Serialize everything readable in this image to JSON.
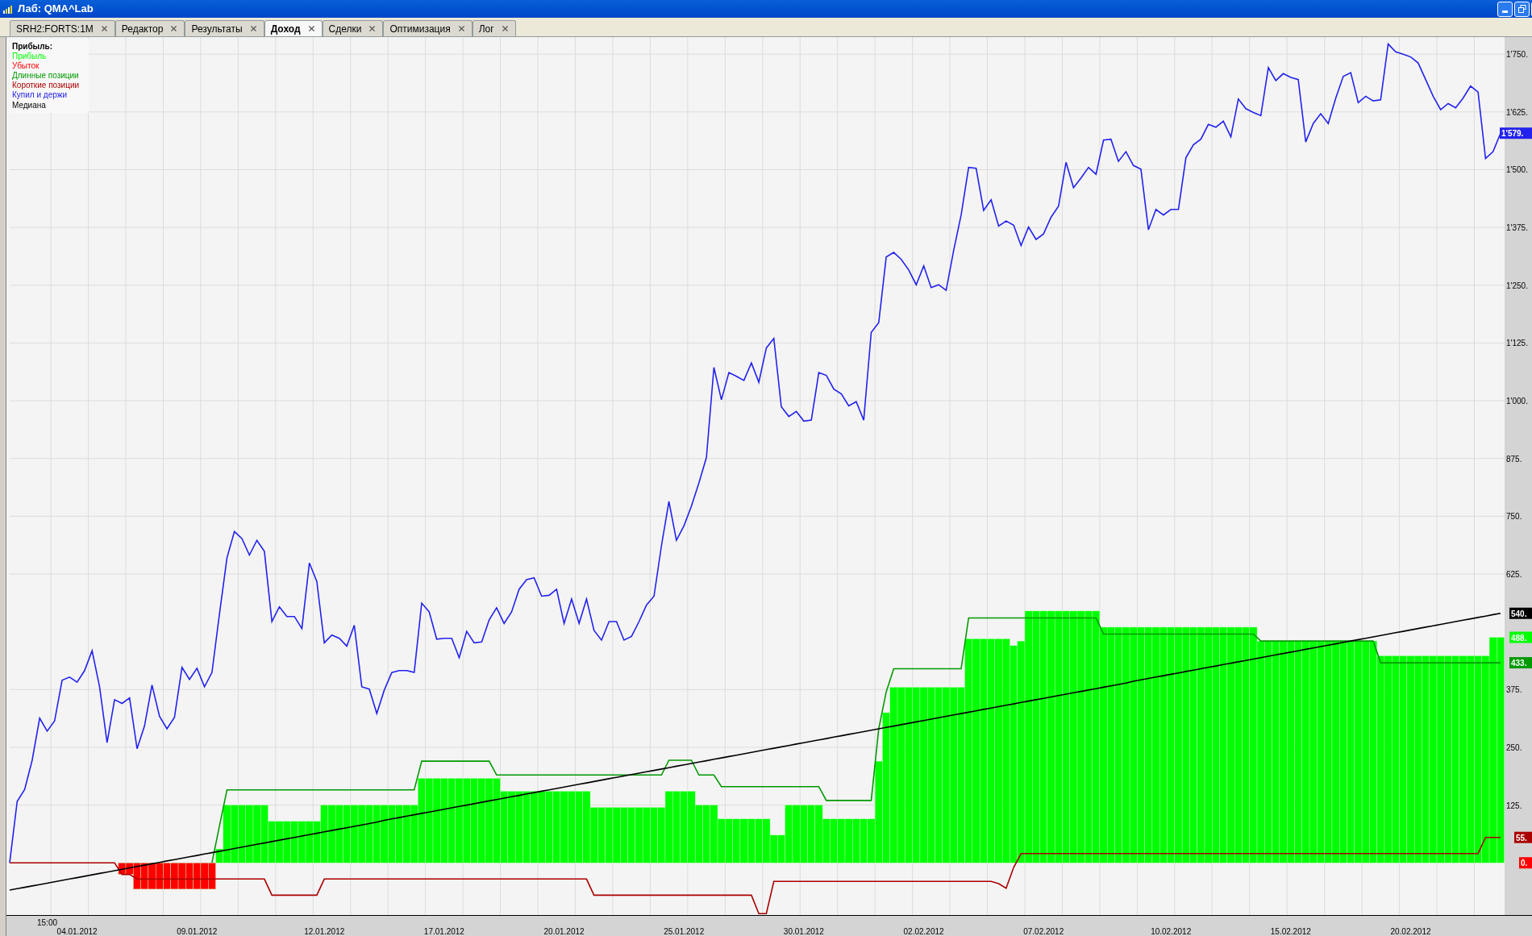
{
  "window": {
    "title": "Лаб: QMA^Lab"
  },
  "tabs": [
    {
      "label": "SRH2:FORTS:1M",
      "selected": false
    },
    {
      "label": "Редактор",
      "selected": false
    },
    {
      "label": "Результаты",
      "selected": false
    },
    {
      "label": "Доход",
      "selected": true
    },
    {
      "label": "Сделки",
      "selected": false
    },
    {
      "label": "Оптимизация",
      "selected": false
    },
    {
      "label": "Лог",
      "selected": false
    }
  ],
  "chart": {
    "time_label": "15:00",
    "end_labels": [
      {
        "text": "1'579.",
        "color": "#2222ee"
      },
      {
        "text": "540.",
        "color": "#000000"
      },
      {
        "text": "488.",
        "color": "#00ff00"
      },
      {
        "text": "433.",
        "color": "#009900"
      },
      {
        "text": "55.",
        "color": "#aa0000"
      },
      {
        "text": "0.",
        "color": "#ff0000"
      }
    ],
    "chart_data": {
      "type": "bar",
      "stacked": false,
      "grid": true,
      "title": "Прибыль:",
      "ylim": [
        -113,
        1787
      ],
      "categories": [
        null,
        null,
        null,
        null,
        null,
        null,
        null,
        null,
        null,
        "04.01.2012",
        null,
        null,
        null,
        null,
        null,
        null,
        null,
        null,
        null,
        null,
        null,
        null,
        null,
        null,
        null,
        "09.01.2012",
        null,
        null,
        null,
        null,
        null,
        null,
        null,
        null,
        null,
        null,
        null,
        null,
        null,
        null,
        null,
        null,
        "12.01.2012",
        null,
        null,
        null,
        null,
        null,
        null,
        null,
        null,
        null,
        null,
        null,
        null,
        null,
        null,
        null,
        "17.01.2012",
        null,
        null,
        null,
        null,
        null,
        null,
        null,
        null,
        null,
        null,
        null,
        null,
        null,
        null,
        null,
        "20.01.2012",
        null,
        null,
        null,
        null,
        null,
        null,
        null,
        null,
        null,
        null,
        null,
        null,
        null,
        null,
        null,
        "25.01.2012",
        null,
        null,
        null,
        null,
        null,
        null,
        null,
        null,
        null,
        null,
        null,
        null,
        null,
        null,
        null,
        "30.01.2012",
        null,
        null,
        null,
        null,
        null,
        null,
        null,
        null,
        null,
        null,
        null,
        null,
        null,
        null,
        null,
        "02.02.2012",
        null,
        null,
        null,
        null,
        null,
        null,
        null,
        null,
        null,
        null,
        null,
        null,
        null,
        null,
        null,
        "07.02.2012",
        null,
        null,
        null,
        null,
        null,
        null,
        null,
        null,
        null,
        null,
        null,
        null,
        null,
        null,
        null,
        null,
        "10.02.2012",
        null,
        null,
        null,
        null,
        null,
        null,
        null,
        null,
        null,
        null,
        null,
        null,
        null,
        null,
        null,
        "15.02.2012",
        null,
        null,
        null,
        null,
        null,
        null,
        null,
        null,
        null,
        null,
        null,
        null,
        null,
        null,
        null,
        "20.02.2012",
        null,
        null,
        null,
        null,
        null,
        null,
        null,
        null,
        null,
        null,
        null,
        null
      ],
      "yticks": [
        {
          "value": 1750,
          "label": "1'750."
        },
        {
          "value": 1625,
          "label": "1'625."
        },
        {
          "value": 1500,
          "label": "1'500."
        },
        {
          "value": 1375,
          "label": "1'375."
        },
        {
          "value": 1250,
          "label": "1'250."
        },
        {
          "value": 1125,
          "label": "1'125."
        },
        {
          "value": 1000,
          "label": "1'000."
        },
        {
          "value": 875,
          "label": "875."
        },
        {
          "value": 750,
          "label": "750."
        },
        {
          "value": 625,
          "label": "625."
        },
        {
          "value": 375,
          "label": "375."
        },
        {
          "value": 250,
          "label": "250."
        },
        {
          "value": 125,
          "label": "125."
        }
      ],
      "series": [
        {
          "name": "Прибыль",
          "type": "bar",
          "color": "#00ff00",
          "values": [
            0,
            0,
            0,
            0,
            0,
            0,
            0,
            0,
            0,
            0,
            0,
            0,
            0,
            0,
            0,
            0,
            0,
            0,
            0,
            0,
            0,
            0,
            0,
            0,
            0,
            0,
            0,
            0,
            30,
            125,
            125,
            125,
            125,
            125,
            125,
            90,
            90,
            90,
            90,
            90,
            90,
            90,
            125,
            125,
            125,
            125,
            125,
            125,
            125,
            125,
            125,
            125,
            125,
            125,
            125,
            183,
            183,
            183,
            183,
            183,
            183,
            183,
            183,
            183,
            183,
            183,
            155,
            155,
            155,
            155,
            155,
            155,
            155,
            155,
            155,
            155,
            155,
            155,
            120,
            120,
            120,
            120,
            120,
            120,
            120,
            120,
            120,
            120,
            155,
            155,
            155,
            155,
            125,
            125,
            125,
            95,
            95,
            95,
            95,
            95,
            95,
            95,
            60,
            60,
            125,
            125,
            125,
            125,
            125,
            95,
            95,
            95,
            95,
            95,
            95,
            95,
            220,
            325,
            380,
            380,
            380,
            380,
            380,
            380,
            380,
            380,
            380,
            380,
            485,
            485,
            485,
            485,
            485,
            485,
            470,
            480,
            545,
            545,
            545,
            545,
            545,
            545,
            545,
            545,
            545,
            545,
            510,
            510,
            510,
            510,
            510,
            510,
            510,
            510,
            510,
            510,
            510,
            510,
            510,
            510,
            510,
            510,
            510,
            510,
            510,
            510,
            510,
            480,
            480,
            480,
            480,
            480,
            480,
            480,
            480,
            480,
            480,
            480,
            480,
            480,
            480,
            480,
            480,
            448,
            448,
            448,
            448,
            448,
            448,
            448,
            448,
            448,
            448,
            448,
            448,
            448,
            448,
            448,
            488,
            488
          ]
        },
        {
          "name": "Убыток",
          "type": "bar",
          "color": "#ff0000",
          "values": [
            0,
            0,
            0,
            0,
            0,
            0,
            0,
            0,
            0,
            0,
            0,
            0,
            0,
            0,
            0,
            -25,
            -25,
            -57,
            -57,
            -57,
            -57,
            -57,
            -57,
            -57,
            -57,
            -57,
            -57,
            -57,
            0,
            0,
            0,
            0,
            0,
            0,
            0,
            0,
            0,
            0,
            0,
            0,
            0,
            0,
            0,
            0,
            0,
            0,
            0,
            0,
            0,
            0,
            0,
            0,
            0,
            0,
            0,
            0,
            0,
            0,
            0,
            0,
            0,
            0,
            0,
            0,
            0,
            0,
            0,
            0,
            0,
            0,
            0,
            0,
            0,
            0,
            0,
            0,
            0,
            0,
            0,
            0,
            0,
            0,
            0,
            0,
            0,
            0,
            0,
            0,
            0,
            0,
            0,
            0,
            0,
            0,
            0,
            0,
            0,
            0,
            0,
            0,
            0,
            0,
            0,
            0,
            0,
            0,
            0,
            0,
            0,
            0,
            0,
            0,
            0,
            0,
            0,
            0,
            0,
            0,
            0,
            0,
            0,
            0,
            0,
            0,
            0,
            0,
            0,
            0,
            0,
            0,
            0,
            0,
            0,
            0,
            0,
            0,
            0,
            0,
            0,
            0,
            0,
            0,
            0,
            0,
            0,
            0,
            0,
            0,
            0,
            0,
            0,
            0,
            0,
            0,
            0,
            0,
            0,
            0,
            0,
            0,
            0,
            0,
            0,
            0,
            0,
            0,
            0,
            0,
            0,
            0,
            0,
            0,
            0,
            0,
            0,
            0,
            0,
            0,
            0,
            0,
            0,
            0,
            0,
            0,
            0,
            0,
            0,
            0,
            0,
            0,
            0,
            0,
            0,
            0,
            0,
            0,
            0,
            0,
            0,
            0
          ]
        },
        {
          "name": "Длинные позиции",
          "type": "line",
          "color": "#009900",
          "values": [
            null,
            null,
            null,
            null,
            null,
            null,
            null,
            null,
            null,
            null,
            null,
            null,
            null,
            null,
            null,
            null,
            null,
            null,
            null,
            null,
            null,
            null,
            null,
            null,
            null,
            null,
            null,
            0,
            80,
            158,
            158,
            158,
            158,
            158,
            158,
            158,
            158,
            158,
            158,
            158,
            158,
            158,
            158,
            158,
            158,
            158,
            158,
            158,
            158,
            158,
            158,
            158,
            158,
            158,
            158,
            220,
            220,
            220,
            220,
            220,
            220,
            220,
            220,
            220,
            220,
            190,
            190,
            190,
            190,
            190,
            190,
            190,
            190,
            190,
            190,
            190,
            190,
            190,
            190,
            190,
            190,
            190,
            190,
            190,
            190,
            190,
            190,
            190,
            222,
            222,
            222,
            222,
            190,
            190,
            190,
            165,
            165,
            165,
            165,
            165,
            165,
            165,
            165,
            165,
            165,
            165,
            165,
            165,
            165,
            135,
            135,
            135,
            135,
            135,
            135,
            135,
            290,
            370,
            420,
            420,
            420,
            420,
            420,
            420,
            420,
            420,
            420,
            420,
            530,
            530,
            530,
            530,
            530,
            530,
            530,
            530,
            530,
            530,
            530,
            530,
            530,
            530,
            530,
            530,
            530,
            530,
            495,
            495,
            495,
            495,
            495,
            495,
            495,
            495,
            495,
            495,
            495,
            495,
            495,
            495,
            495,
            495,
            495,
            495,
            495,
            495,
            495,
            480,
            480,
            480,
            480,
            480,
            480,
            480,
            480,
            480,
            480,
            480,
            480,
            480,
            480,
            480,
            480,
            433,
            433,
            433,
            433,
            433,
            433,
            433,
            433,
            433,
            433,
            433,
            433,
            433,
            433,
            433,
            433,
            433
          ]
        },
        {
          "name": "Короткие позиции",
          "type": "line",
          "color": "#aa0000",
          "values": [
            0,
            0,
            0,
            0,
            0,
            0,
            0,
            0,
            0,
            0,
            0,
            0,
            0,
            0,
            0,
            -25,
            -25,
            -35,
            -35,
            -35,
            -35,
            -35,
            -35,
            -35,
            -35,
            -35,
            -35,
            -35,
            -35,
            -35,
            -35,
            -35,
            -35,
            -35,
            -35,
            -70,
            -70,
            -70,
            -70,
            -70,
            -70,
            -70,
            -35,
            -35,
            -35,
            -35,
            -35,
            -35,
            -35,
            -35,
            -35,
            -35,
            -35,
            -35,
            -35,
            -35,
            -35,
            -35,
            -35,
            -35,
            -35,
            -35,
            -35,
            -35,
            -35,
            -35,
            -35,
            -35,
            -35,
            -35,
            -35,
            -35,
            -35,
            -35,
            -35,
            -35,
            -35,
            -35,
            -70,
            -70,
            -70,
            -70,
            -70,
            -70,
            -70,
            -70,
            -70,
            -70,
            -70,
            -70,
            -70,
            -70,
            -70,
            -70,
            -70,
            -70,
            -70,
            -70,
            -70,
            -70,
            -110,
            -110,
            -40,
            -40,
            -40,
            -40,
            -40,
            -40,
            -40,
            -40,
            -40,
            -40,
            -40,
            -40,
            -40,
            -40,
            -40,
            -40,
            -40,
            -40,
            -40,
            -40,
            -40,
            -40,
            -40,
            -40,
            -40,
            -40,
            -40,
            -40,
            -40,
            -40,
            -45,
            -55,
            -10,
            20,
            20,
            20,
            20,
            20,
            20,
            20,
            20,
            20,
            20,
            20,
            20,
            20,
            20,
            20,
            20,
            20,
            20,
            20,
            20,
            20,
            20,
            20,
            20,
            20,
            20,
            20,
            20,
            20,
            20,
            20,
            20,
            20,
            20,
            20,
            20,
            20,
            20,
            20,
            20,
            20,
            20,
            20,
            20,
            20,
            20,
            20,
            20,
            20,
            20,
            20,
            20,
            20,
            20,
            20,
            20,
            20,
            20,
            20,
            20,
            20,
            20,
            55,
            55,
            55
          ]
        },
        {
          "name": "Купил и держи",
          "type": "line",
          "color": "#2222ee",
          "values": [
            0,
            133,
            159,
            222,
            313,
            285,
            307,
            395,
            402,
            391,
            416,
            459,
            381,
            260,
            353,
            345,
            357,
            247,
            296,
            385,
            317,
            290,
            315,
            423,
            397,
            421,
            381,
            412,
            539,
            660,
            717,
            702,
            666,
            698,
            674,
            522,
            554,
            533,
            533,
            507,
            649,
            609,
            476,
            493,
            486,
            469,
            514,
            381,
            376,
            323,
            374,
            412,
            416,
            416,
            412,
            562,
            543,
            484,
            486,
            486,
            444,
            501,
            476,
            478,
            526,
            552,
            518,
            543,
            592,
            613,
            617,
            577,
            579,
            592,
            518,
            571,
            518,
            571,
            503,
            482,
            522,
            522,
            482,
            490,
            522,
            558,
            577,
            687,
            782,
            698,
            729,
            772,
            822,
            877,
            1072,
            1002,
            1061,
            1053,
            1044,
            1082,
            1040,
            1114,
            1135,
            987,
            966,
            977,
            956,
            958,
            1061,
            1055,
            1025,
            1015,
            989,
            998,
            958,
            1148,
            1169,
            1311,
            1321,
            1306,
            1283,
            1251,
            1292,
            1245,
            1251,
            1239,
            1325,
            1402,
            1505,
            1503,
            1412,
            1435,
            1378,
            1389,
            1380,
            1336,
            1376,
            1349,
            1361,
            1397,
            1421,
            1516,
            1461,
            1482,
            1505,
            1490,
            1564,
            1566,
            1518,
            1539,
            1509,
            1501,
            1370,
            1414,
            1402,
            1414,
            1414,
            1526,
            1554,
            1566,
            1598,
            1592,
            1605,
            1571,
            1653,
            1632,
            1624,
            1617,
            1721,
            1693,
            1708,
            1700,
            1695,
            1560,
            1600,
            1621,
            1600,
            1655,
            1702,
            1710,
            1645,
            1659,
            1649,
            1651,
            1772,
            1755,
            1750,
            1744,
            1731,
            1695,
            1659,
            1630,
            1643,
            1634,
            1655,
            1681,
            1668,
            1524,
            1539,
            1579
          ]
        },
        {
          "name": "Медиана",
          "type": "line",
          "color": "#000000",
          "values": [
            -59,
            -56,
            -53,
            -50,
            -47,
            -44,
            -41,
            -38,
            -35,
            -32,
            -29,
            -26,
            -23,
            -20,
            -17,
            -14,
            -11,
            -8,
            -5,
            -2,
            1,
            4,
            7,
            10,
            13,
            16,
            19,
            22,
            25,
            28,
            31,
            34,
            37,
            40,
            43,
            46,
            49,
            52,
            55,
            58,
            61,
            64,
            67,
            70,
            73,
            76,
            79,
            82,
            85,
            88,
            92,
            95,
            98,
            101,
            104,
            107,
            110,
            113,
            116,
            119,
            122,
            125,
            128,
            131,
            134,
            137,
            140,
            143,
            146,
            149,
            152,
            155,
            158,
            161,
            164,
            167,
            170,
            173,
            176,
            179,
            182,
            185,
            188,
            191,
            194,
            197,
            200,
            203,
            206,
            209,
            212,
            215,
            218,
            221,
            224,
            227,
            230,
            233,
            236,
            239,
            242,
            245,
            248,
            251,
            254,
            257,
            260,
            263,
            266,
            269,
            272,
            275,
            278,
            281,
            284,
            287,
            290,
            293,
            296,
            299,
            302,
            305,
            308,
            311,
            314,
            317,
            320,
            323,
            326,
            329,
            332,
            335,
            338,
            341,
            344,
            347,
            350,
            353,
            356,
            359,
            362,
            365,
            368,
            371,
            374,
            377,
            380,
            383,
            386,
            389,
            393,
            396,
            399,
            402,
            405,
            408,
            411,
            414,
            417,
            420,
            423,
            426,
            429,
            432,
            435,
            438,
            441,
            444,
            447,
            450,
            453,
            456,
            459,
            462,
            465,
            468,
            471,
            474,
            477,
            480,
            483,
            486,
            489,
            492,
            495,
            498,
            501,
            504,
            507,
            510,
            513,
            516,
            519,
            522,
            525,
            528,
            531,
            534,
            537,
            540
          ]
        }
      ]
    }
  }
}
